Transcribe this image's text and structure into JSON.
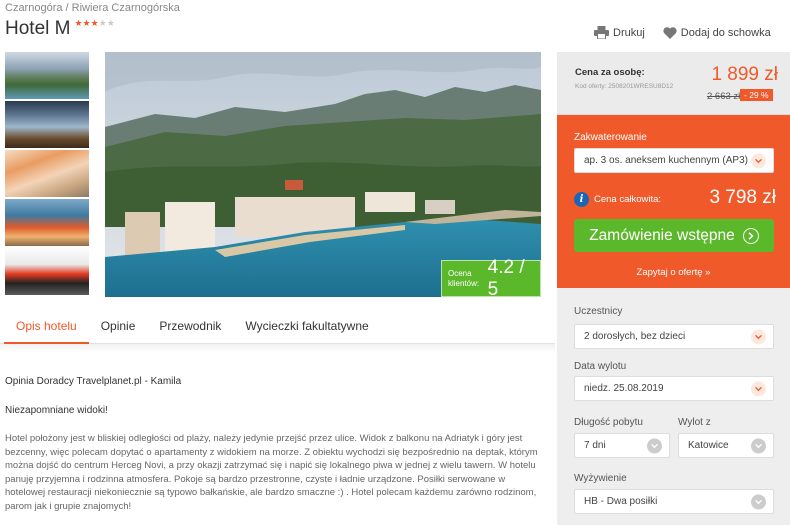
{
  "breadcrumb": {
    "country": "Czarnogóra",
    "separator": "/",
    "region": "Riwiera Czarnogórska"
  },
  "hotel": {
    "name": "Hotel M",
    "stars_filled": "★★★",
    "stars_empty": "★★"
  },
  "actions": {
    "print": "Drukuj",
    "save": "Dodaj do schowka"
  },
  "rating": {
    "label": "Ocena klientów:",
    "value": "4.2 / 5"
  },
  "tabs": [
    "Opis hotelu",
    "Opinie",
    "Przewodnik",
    "Wycieczki fakultatywne"
  ],
  "review": {
    "author": "Opinia Doradcy Travelplanet.pl - Kamila",
    "title": "Niezapomniane widoki!",
    "body": "Hotel położony jest w bliskiej odległości od plaży, należy jedynie przejść przez ulice. Widok z balkonu na Adriatyk i góry jest bezcenny, więc polecam dopytać o apartamenty z widokiem na morze. Z obiektu wychodzi się bezpośrednio na deptak, którym można dojść do centrum Herceg Novi, a przy okazji zatrzymać się i napić się lokalnego piwa w jednej z wielu tawern. W hotelu panuję przyjemna i rodzinna atmosfera. Pokoje są bardzo przestronne, czyste i ładnie urządzone. Posiłki serwowane w hotelowej restauracji niekoniecznie są typowo bałkańskie, ale bardzo smaczne :) . Hotel polecam każdemu zarówno rodzinom, parom jak i grupie znajomych!"
  },
  "price": {
    "label": "Cena za osobę:",
    "offer_code": "Kod oferty: 2508201WRESU8D12",
    "current": "1 899 zł",
    "old": "2 663 zł",
    "discount": "- 29 %"
  },
  "booking": {
    "accommodation_label": "Zakwaterowanie",
    "accommodation_value": "ap. 3 os. aneksem kuchennym (AP3)",
    "total_label": "Cena całkowita:",
    "total_value": "3 798 zł",
    "order_button": "Zamówienie wstępne",
    "ask_link": "Zapytaj o ofertę »"
  },
  "filters": {
    "participants_label": "Uczestnicy",
    "participants_value": "2 dorosłych, bez dzieci",
    "date_label": "Data wylotu",
    "date_value": "niedz. 25.08.2019",
    "duration_label": "Długość pobytu",
    "duration_value": "7 dni",
    "departure_label": "Wylot z",
    "departure_value": "Katowice",
    "board_label": "Wyżywienie",
    "board_value": "HB - Dwa posiłki"
  },
  "colors": {
    "accent": "#f0592a",
    "green": "#5cb82b",
    "info": "#1a66b5"
  }
}
